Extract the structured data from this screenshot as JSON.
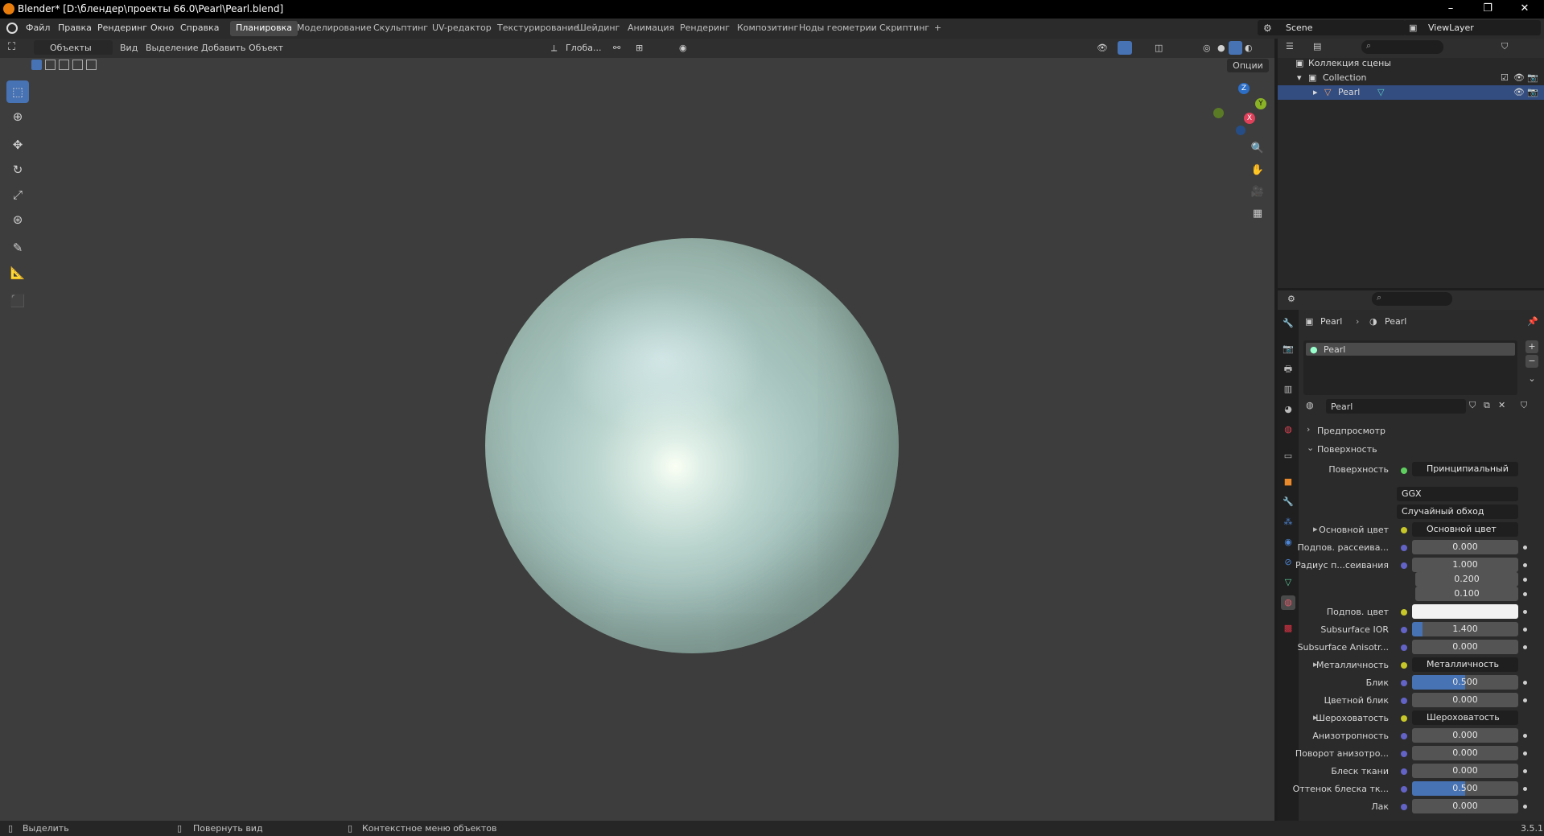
{
  "titlebar": {
    "title": "Blender* [D:\\блендер\\проекты 66.0\\Pearl\\Pearl.blend]",
    "minimize": "–",
    "maximize": "❐",
    "close": "✕"
  },
  "menu": {
    "file": "Файл",
    "edit": "Правка",
    "render": "Рендеринг",
    "window": "Окно",
    "help": "Справка"
  },
  "workspaces": [
    "Планировка",
    "Моделирование",
    "Скульптинг",
    "UV-редактор",
    "Текстурирование",
    "Шейдинг",
    "Анимация",
    "Рендеринг",
    "Композитинг",
    "Ноды геометрии",
    "Скриптинг",
    "+"
  ],
  "active_workspace": "Планировка",
  "scene": {
    "label": "Scene",
    "viewlayer": "ViewLayer"
  },
  "viewport": {
    "mode": "Объекты",
    "menus": [
      "Вид",
      "Выделение",
      "Добавить",
      "Объект"
    ],
    "transform_orientation": "Глоба...",
    "options": "Опции",
    "gizmo": {
      "z": "Z",
      "y": "Y",
      "x": "X"
    }
  },
  "outliner": {
    "scene_collection": "Коллекция сцены",
    "collection": "Collection",
    "object": "Pearl"
  },
  "properties": {
    "breadcrumb_object": "Pearl",
    "breadcrumb_material": "Pearl",
    "slot": "Pearl",
    "material_name": "Pearl",
    "sections": {
      "preview": "Предпросмотр",
      "surface": "Поверхность"
    },
    "surface_label": "Поверхность",
    "surface_value": "Принципиальный BSDF",
    "distribution": "GGX",
    "subsurface_method": "Случайный обход",
    "rows": [
      {
        "label": "Основной цвет",
        "value": "Основной цвет",
        "kind": "link",
        "expand": "▸"
      },
      {
        "label": "Подпов. рассеива...",
        "value": "0.000",
        "kind": "num",
        "fill": 0
      },
      {
        "label": "Радиус п...сеивания",
        "value": "1.000",
        "kind": "num",
        "fill": 0
      },
      {
        "label": "",
        "value": "0.200",
        "kind": "num",
        "fill": 0
      },
      {
        "label": "",
        "value": "0.100",
        "kind": "num",
        "fill": 0
      },
      {
        "label": "Подпов. цвет",
        "value": "",
        "kind": "color",
        "fill": 0
      },
      {
        "label": "Subsurface IOR",
        "value": "1.400",
        "kind": "num",
        "fill": 0.1
      },
      {
        "label": "Subsurface Anisotr...",
        "value": "0.000",
        "kind": "num",
        "fill": 0
      },
      {
        "label": "Металличность",
        "value": "Металличность",
        "kind": "link",
        "expand": "▸"
      },
      {
        "label": "Блик",
        "value": "0.500",
        "kind": "num",
        "fill": 0.5
      },
      {
        "label": "Цветной блик",
        "value": "0.000",
        "kind": "num",
        "fill": 0
      },
      {
        "label": "Шероховатость",
        "value": "Шероховатость",
        "kind": "link",
        "expand": "▸"
      },
      {
        "label": "Анизотропность",
        "value": "0.000",
        "kind": "num",
        "fill": 0
      },
      {
        "label": "Поворот анизотро...",
        "value": "0.000",
        "kind": "num",
        "fill": 0
      },
      {
        "label": "Блеск ткани",
        "value": "0.000",
        "kind": "num",
        "fill": 0
      },
      {
        "label": "Оттенок блеска тк...",
        "value": "0.500",
        "kind": "num",
        "fill": 0.5
      },
      {
        "label": "Лак",
        "value": "0.000",
        "kind": "num",
        "fill": 0
      }
    ]
  },
  "status": {
    "select": "Выделить",
    "rotate": "Повернуть вид",
    "context": "Контекстное меню объектов",
    "version": "3.5.1"
  },
  "colors": {
    "accent": "#4772b3",
    "selection": "#334d80",
    "orange": "#e87d0d"
  }
}
